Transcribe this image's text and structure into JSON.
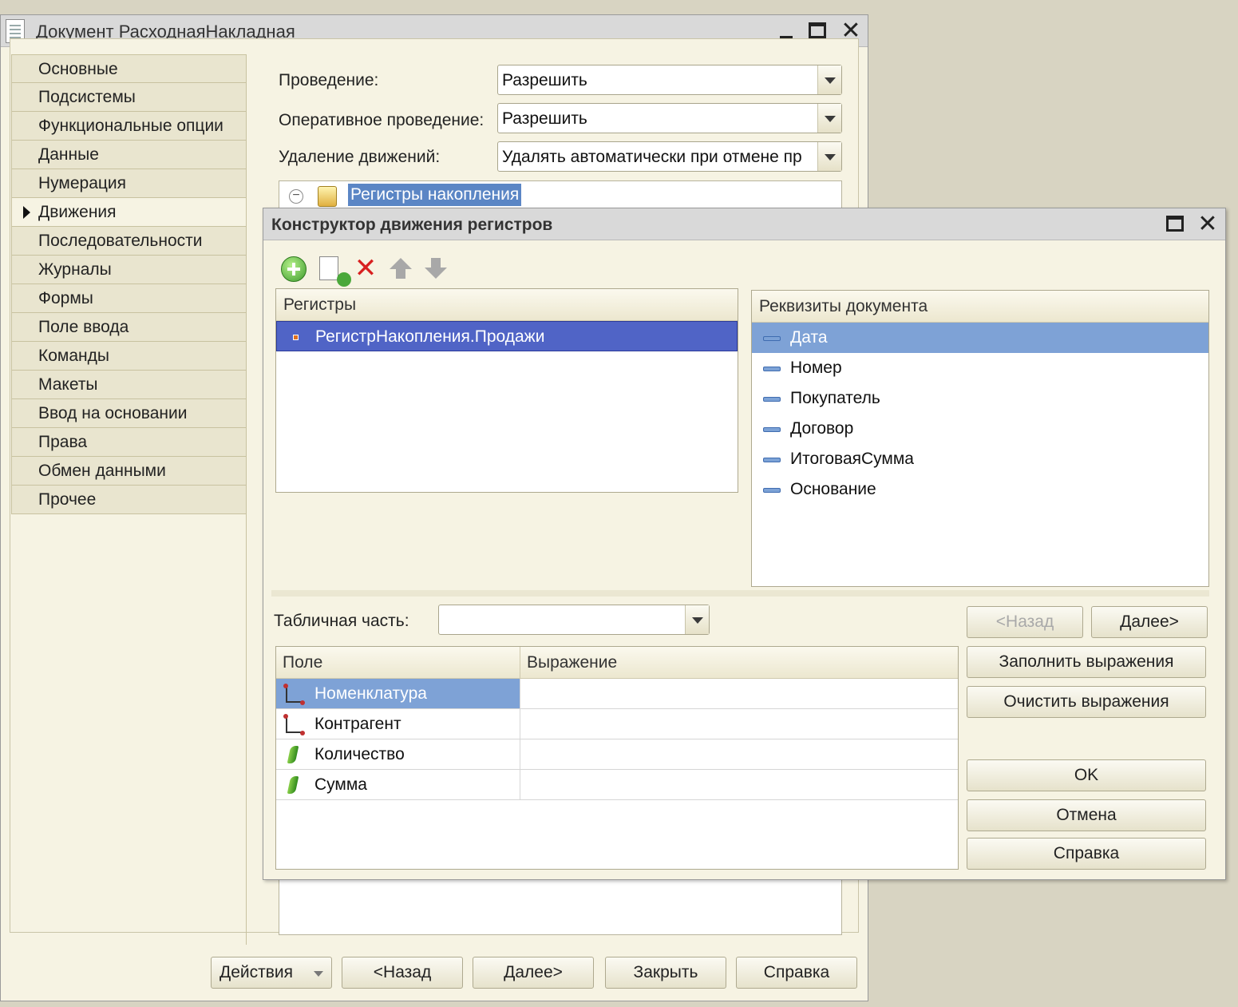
{
  "main_window": {
    "title": "Документ РасходнаяНакладная",
    "nav_items": [
      {
        "label": "Основные"
      },
      {
        "label": "Подсистемы"
      },
      {
        "label": "Функциональные опции"
      },
      {
        "label": "Данные"
      },
      {
        "label": "Нумерация"
      },
      {
        "label": "Движения"
      },
      {
        "label": "Последовательности"
      },
      {
        "label": "Журналы"
      },
      {
        "label": "Формы"
      },
      {
        "label": "Поле ввода"
      },
      {
        "label": "Команды"
      },
      {
        "label": "Макеты"
      },
      {
        "label": "Ввод на основании"
      },
      {
        "label": "Права"
      },
      {
        "label": "Обмен данными"
      },
      {
        "label": "Прочее"
      }
    ],
    "active_nav": "Движения",
    "fields": {
      "posting_label": "Проведение:",
      "posting_value": "Разрешить",
      "realtime_label": "Оперативное проведение:",
      "realtime_value": "Разрешить",
      "delete_label": "Удаление движений:",
      "delete_value": "Удалять автоматически при отмене пр"
    },
    "tree": {
      "node_label": "Регистры накопления"
    },
    "buttons": {
      "actions": "Действия",
      "back": "<Назад",
      "next": "Далее>",
      "close": "Закрыть",
      "help": "Справка"
    }
  },
  "dialog": {
    "title": "Конструктор движения регистров",
    "toolbar_icons": [
      "add-icon",
      "copy-icon",
      "delete-icon",
      "move-up-icon",
      "move-down-icon"
    ],
    "registers": {
      "header": "Регистры",
      "items": [
        "РегистрНакопления.Продажи"
      ]
    },
    "attributes": {
      "header": "Реквизиты документа",
      "items": [
        "Дата",
        "Номер",
        "Покупатель",
        "Договор",
        "ИтоговаяСумма",
        "Основание"
      ]
    },
    "tabular_label": "Табличная часть:",
    "tabular_value": "",
    "grid": {
      "col_field": "Поле",
      "col_expression": "Выражение",
      "rows": [
        {
          "field": "Номенклатура",
          "expression": "",
          "kind": "dimension"
        },
        {
          "field": "Контрагент",
          "expression": "",
          "kind": "dimension"
        },
        {
          "field": "Количество",
          "expression": "",
          "kind": "resource"
        },
        {
          "field": "Сумма",
          "expression": "",
          "kind": "resource"
        }
      ]
    },
    "buttons": {
      "back": "<Назад",
      "next": "Далее>",
      "fill": "Заполнить выражения",
      "clear": "Очистить выражения",
      "ok": "OK",
      "cancel": "Отмена",
      "help": "Справка"
    }
  }
}
